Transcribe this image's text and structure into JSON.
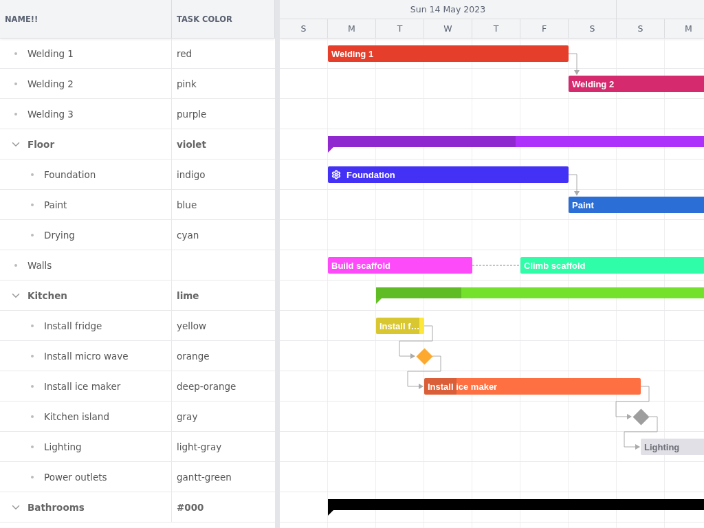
{
  "grid": {
    "columns": [
      "NAME!!",
      "TASK COLOR"
    ],
    "rows": [
      {
        "name": "Welding 1",
        "task_color": "red",
        "bars": [
          {
            "kind": "task",
            "label": "Welding 1",
            "color": "#e53e2b"
          }
        ]
      },
      {
        "name": "Welding 2",
        "task_color": "pink",
        "bars": [
          {
            "kind": "task",
            "label": "Welding 2",
            "color": "#d62a6e"
          }
        ]
      },
      {
        "name": "Welding 3",
        "task_color": "purple"
      },
      {
        "name": "Floor",
        "task_color": "violet",
        "expanded": true,
        "bars": [
          {
            "kind": "summary",
            "color": "#ae31fb",
            "level": 0.44
          }
        ],
        "children": [
          {
            "name": "Foundation",
            "task_color": "indigo",
            "bars": [
              {
                "kind": "task",
                "label": "Foundation",
                "color": "#4331f5"
              }
            ]
          },
          {
            "name": "Paint",
            "task_color": "blue",
            "bars": [
              {
                "kind": "task",
                "label": "Paint",
                "color": "#2b6ed6"
              }
            ]
          },
          {
            "name": "Drying",
            "task_color": "cyan"
          }
        ]
      },
      {
        "name": "Walls",
        "bars": [
          {
            "kind": "task",
            "label": "Build scaffold",
            "color": "#fd4bfa"
          },
          {
            "kind": "task",
            "label": "Climb scaffold",
            "color": "#2ffda8"
          }
        ]
      },
      {
        "name": "Kitchen",
        "task_color": "lime",
        "expanded": true,
        "bars": [
          {
            "kind": "summary",
            "color": "#74e22d",
            "level": 0.23
          }
        ],
        "children": [
          {
            "name": "Install fridge",
            "task_color": "yellow",
            "bars": [
              {
                "kind": "task",
                "label": "Install f…",
                "color": "#fde83a",
                "level": 0.9
              }
            ]
          },
          {
            "name": "Install micro wave",
            "task_color": "orange",
            "bars": [
              {
                "kind": "milestone",
                "color": "#fda92f"
              }
            ]
          },
          {
            "name": "Install ice maker",
            "task_color": "deep-orange",
            "bars": [
              {
                "kind": "task",
                "label": "Install ice maker",
                "color": "#fe6f42",
                "level": 0.15
              }
            ]
          },
          {
            "name": "Kitchen island",
            "task_color": "gray",
            "bars": [
              {
                "kind": "milestone",
                "color": "#9e9e9e"
              }
            ]
          },
          {
            "name": "Lighting",
            "task_color": "light-gray",
            "bars": [
              {
                "kind": "task",
                "label": "Lighting",
                "color": "#e0e0e6"
              }
            ]
          },
          {
            "name": "Power outlets",
            "task_color": "gantt-green"
          }
        ]
      },
      {
        "name": "Bathrooms",
        "task_color": "#000",
        "expanded": true,
        "bars": [
          {
            "kind": "summary",
            "color": "#000000"
          }
        ],
        "children": []
      }
    ]
  },
  "timeline": {
    "weeks": [
      "Sun 14 May 2023"
    ],
    "days": [
      "S",
      "M",
      "T",
      "W",
      "T",
      "F",
      "S",
      "S",
      "M"
    ]
  }
}
